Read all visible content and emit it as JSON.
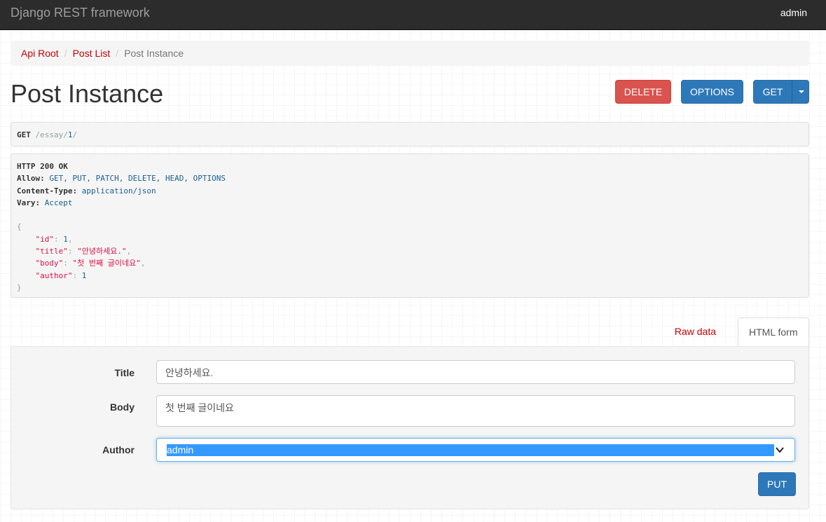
{
  "navbar": {
    "brand": "Django REST framework",
    "user": "admin"
  },
  "breadcrumb": [
    {
      "label": "Api Root"
    },
    {
      "label": "Post List"
    },
    {
      "label": "Post Instance"
    }
  ],
  "page": {
    "title": "Post Instance"
  },
  "actions": {
    "delete_label": "DELETE",
    "options_label": "OPTIONS",
    "get_label": "GET"
  },
  "request": {
    "method": "GET",
    "path_prefix": "/essay/",
    "path_id": "1",
    "path_suffix": "/"
  },
  "response": {
    "status_line": "HTTP 200 OK",
    "headers": [
      {
        "name": "Allow:",
        "value": "GET, PUT, PATCH, DELETE, HEAD, OPTIONS"
      },
      {
        "name": "Content-Type:",
        "value": "application/json"
      },
      {
        "name": "Vary:",
        "value": "Accept"
      }
    ],
    "body": {
      "open": "{",
      "close": "}",
      "lines": [
        {
          "key": "\"id\"",
          "value": "1",
          "kind": "lit",
          "trail": ","
        },
        {
          "key": "\"title\"",
          "value": "\"안녕하세요.\"",
          "kind": "str",
          "trail": ","
        },
        {
          "key": "\"body\"",
          "value": "\"첫 번째 글이네요\"",
          "kind": "str",
          "trail": ","
        },
        {
          "key": "\"author\"",
          "value": "1",
          "kind": "lit",
          "trail": ""
        }
      ]
    }
  },
  "tabs": {
    "raw": "Raw data",
    "html": "HTML form"
  },
  "form": {
    "title_label": "Title",
    "title_value": "안녕하세요.",
    "body_label": "Body",
    "body_value": "첫 번째 글이네요",
    "author_label": "Author",
    "author_selected": "admin",
    "submit_label": "PUT"
  }
}
